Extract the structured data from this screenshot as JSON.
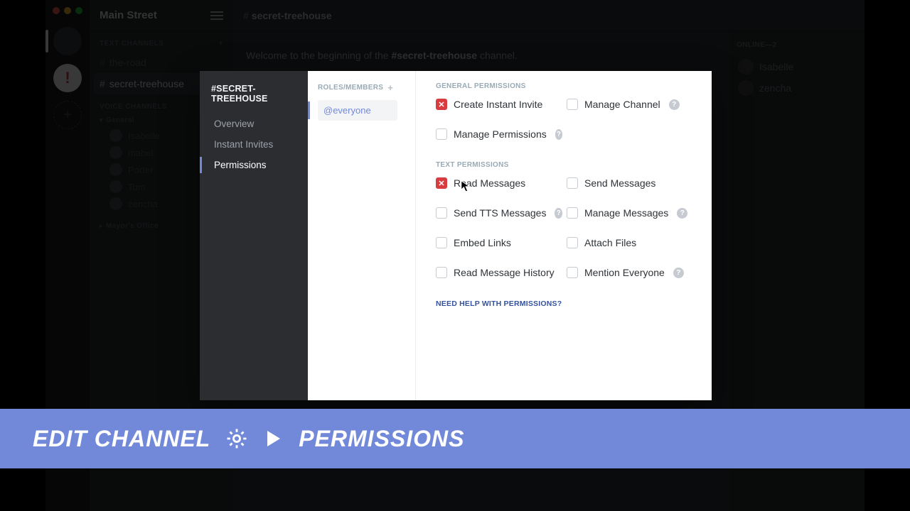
{
  "server": {
    "name": "Main Street"
  },
  "textChannels": {
    "header": "TEXT CHANNELS",
    "items": [
      {
        "name": "the-road",
        "active": false
      },
      {
        "name": "secret-treehouse",
        "active": true
      }
    ]
  },
  "voiceChannels": {
    "header": "VOICE CHANNELS",
    "general": "General",
    "users": [
      "Isabelle",
      "mabel",
      "Porter",
      "Tom",
      "zencha"
    ],
    "collapsedGroup": "Mayor's Office"
  },
  "chat": {
    "channel": "secret-treehouse",
    "welcome_prefix": "Welcome to ",
    "welcome_mid": "the beginning of the ",
    "welcome_channel": "#secret-treehouse",
    "welcome_suffix": " channel."
  },
  "members": {
    "header": "ONLINE—2",
    "list": [
      "Isabelle",
      "zencha"
    ]
  },
  "modal": {
    "title": "#SECRET-TREEHOUSE",
    "side": {
      "overview": "Overview",
      "invites": "Instant Invites",
      "permissions": "Permissions"
    },
    "roles_header": "ROLES/MEMBERS",
    "everyone": "@everyone",
    "sections": {
      "general": "GENERAL PERMISSIONS",
      "text": "TEXT PERMISSIONS"
    },
    "perms": {
      "create_invite": "Create Instant Invite",
      "manage_channel": "Manage Channel",
      "manage_permissions": "Manage Permissions",
      "read_messages": "Read Messages",
      "send_messages": "Send Messages",
      "send_tts": "Send TTS Messages",
      "manage_messages": "Manage Messages",
      "embed_links": "Embed Links",
      "attach_files": "Attach Files",
      "read_history": "Read Message History",
      "mention_everyone": "Mention Everyone"
    },
    "need_help": "NEED HELP WITH PERMISSIONS?"
  },
  "banner": {
    "edit": "EDIT CHANNEL",
    "permissions": "PERMISSIONS"
  }
}
